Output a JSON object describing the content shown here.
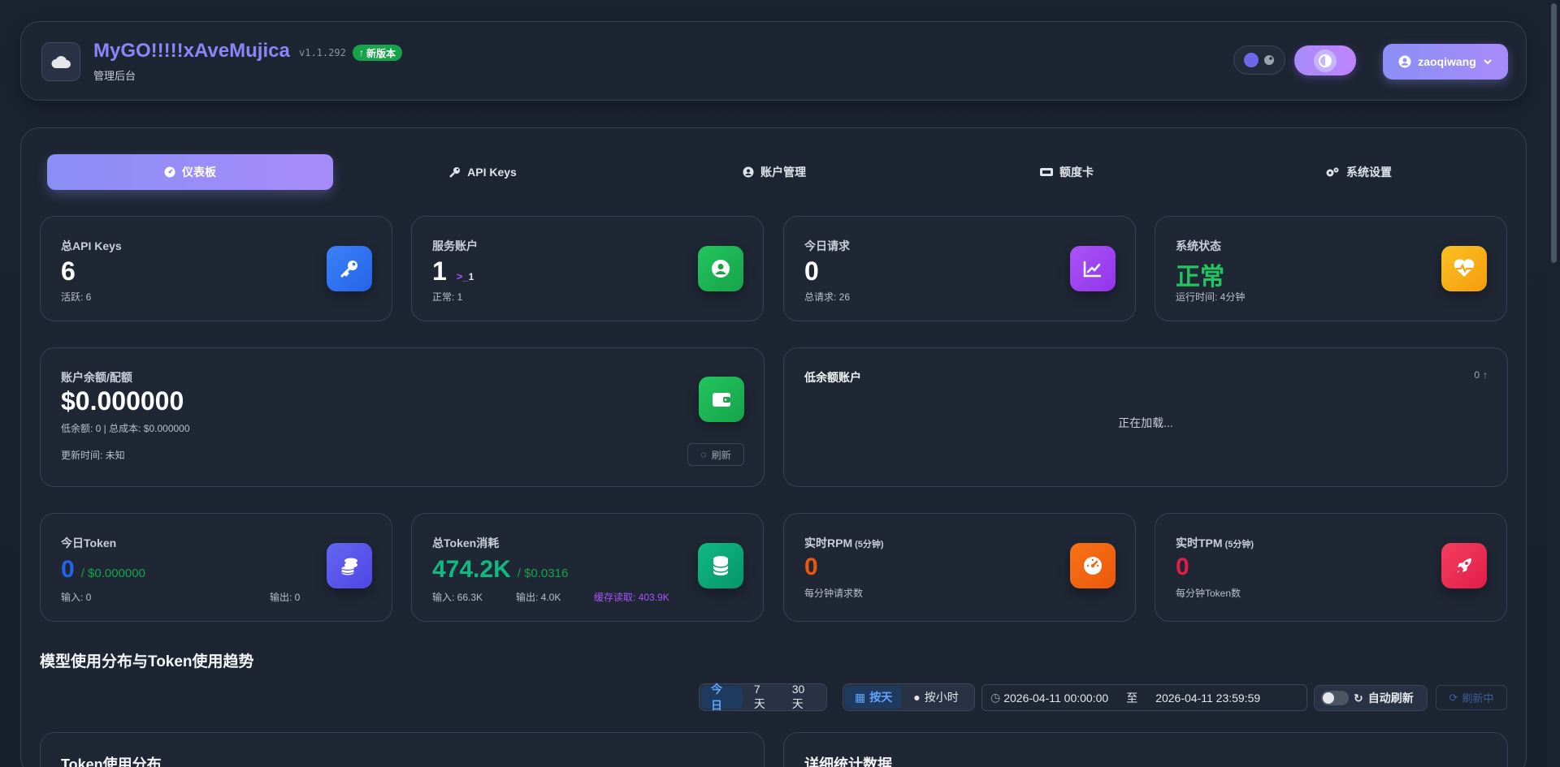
{
  "header": {
    "app_title": "MyGO!!!!!xAveMujica",
    "version": "v1.1.292",
    "new_version_badge": "新版本",
    "subtitle": "管理后台",
    "username": "zaoqiwang"
  },
  "tabs": [
    {
      "label": "仪表板",
      "icon": "dashboard-icon",
      "active": true
    },
    {
      "label": "API Keys",
      "icon": "key-icon",
      "active": false
    },
    {
      "label": "账户管理",
      "icon": "user-circle-icon",
      "active": false
    },
    {
      "label": "额度卡",
      "icon": "ticket-icon",
      "active": false
    },
    {
      "label": "系统设置",
      "icon": "gears-icon",
      "active": false
    }
  ],
  "stats_row1": {
    "api_keys": {
      "label": "总API Keys",
      "value": "6",
      "sub": "活跃: 6",
      "color": "#3b82f6"
    },
    "service_accounts": {
      "label": "服务账户",
      "value": "1",
      "terminal_count": "1",
      "sub": "正常: 1",
      "color": "#16a34a"
    },
    "today_requests": {
      "label": "今日请求",
      "value": "0",
      "sub": "总请求: 26",
      "color": "#a855f7"
    },
    "system_status": {
      "label": "系统状态",
      "value": "正常",
      "sub": "运行时间: 4分钟",
      "color": "#f59e0b"
    }
  },
  "balance": {
    "label": "账户余额/配额",
    "value": "$0.000000",
    "detail": "低余额: 0 | 总成本: $0.000000",
    "updated": "更新时间: 未知",
    "refresh_label": "刷新"
  },
  "low_balance": {
    "title": "低余额账户",
    "count": "0",
    "loading": "正在加载..."
  },
  "stats_row2": {
    "today_token": {
      "label": "今日Token",
      "value": "0",
      "cost": "/ $0.000000",
      "input": "输入: 0",
      "output": "输出: 0"
    },
    "total_token": {
      "label": "总Token消耗",
      "value": "474.2K",
      "cost": "/ $0.0316",
      "input": "输入: 66.3K",
      "output": "输出: 4.0K",
      "cache": "缓存读取: 403.9K"
    },
    "rpm": {
      "label": "实时RPM",
      "window": "(5分钟)",
      "value": "0",
      "sub": "每分钟请求数"
    },
    "tpm": {
      "label": "实时TPM",
      "window": "(5分钟)",
      "value": "0",
      "sub": "每分钟Token数"
    }
  },
  "trend": {
    "title": "模型使用分布与Token使用趋势",
    "ranges": [
      "今日",
      "7天",
      "30天"
    ],
    "granularity": [
      "按天",
      "按小时"
    ],
    "start": "2026-04-11 00:00:00",
    "to": "至",
    "end": "2026-04-11 23:59:59",
    "auto_refresh": "自动刷新",
    "refreshing": "刷新中"
  },
  "bottom": {
    "left_title": "Token使用分布",
    "right_title": "详细统计数据"
  }
}
